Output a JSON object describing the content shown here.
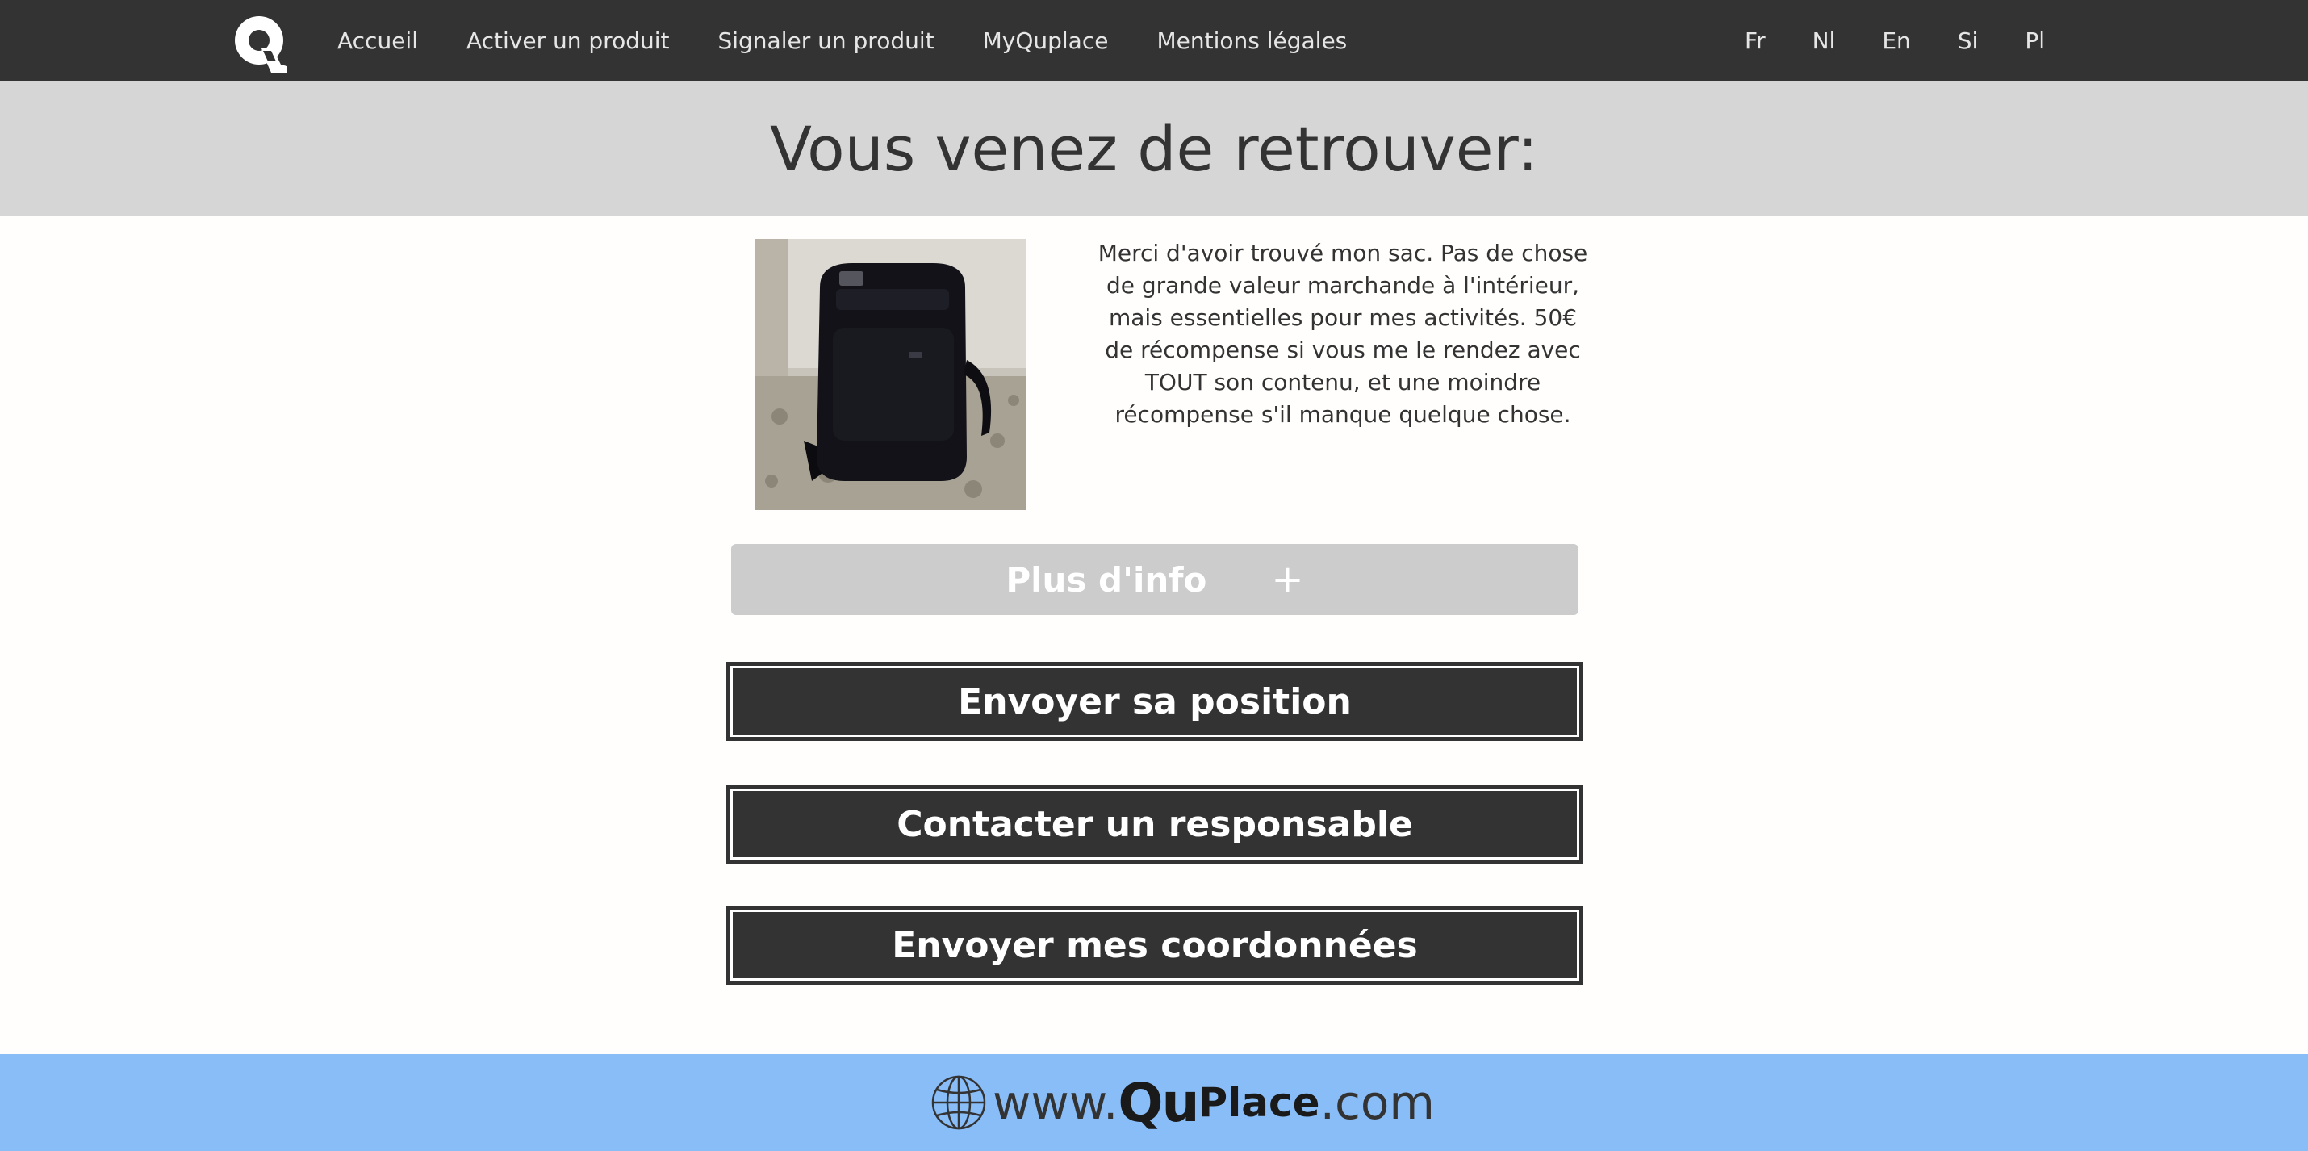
{
  "nav": {
    "links": [
      "Accueil",
      "Activer un produit",
      "Signaler un produit",
      "MyQuplace",
      "Mentions légales"
    ],
    "languages": [
      "Fr",
      "Nl",
      "En",
      "Si",
      "Pl"
    ]
  },
  "header": {
    "title": "Vous venez de retrouver:"
  },
  "product": {
    "image_icon": "backpack-photo",
    "description": "Merci d'avoir trouvé mon sac. Pas de chose de grande valeur marchande à l'intérieur, mais essentielles pour mes activités. 50€ de récompense si vous me le rendez avec TOUT son contenu, et une moindre récompense s'il manque quelque chose."
  },
  "more_info": {
    "label": "Plus d'info",
    "icon": "+"
  },
  "actions": {
    "send_position": "Envoyer sa position",
    "contact_manager": "Contacter un responsable",
    "send_details": "Envoyer mes coordonnées"
  },
  "footer": {
    "prefix": "www.",
    "brand_q": "Qu",
    "brand_rest": "Place",
    "suffix": ".com"
  },
  "colors": {
    "nav_bg": "#333333",
    "band_bg": "#d6d6d6",
    "button_bg": "#333333",
    "more_info_bg": "#cccccc",
    "footer_bg": "#89bdf7"
  }
}
